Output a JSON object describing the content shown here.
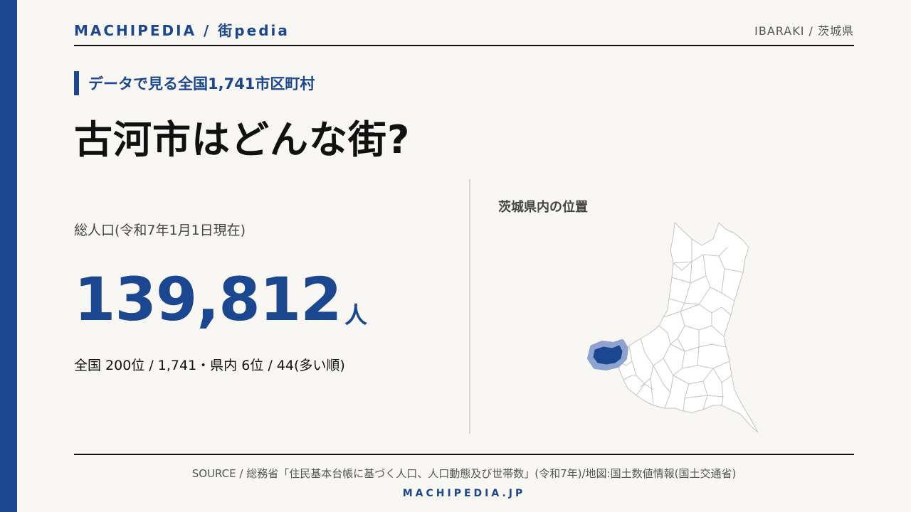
{
  "header": {
    "brand": "MACHIPEDIA / 街pedia",
    "prefecture": "IBARAKI / 茨城県"
  },
  "kicker": "データで見る全国1,741市区町村",
  "title": "古河市はどんな街?",
  "population": {
    "label": "総人口(令和7年1月1日現在)",
    "value": "139,812",
    "unit": "人",
    "rank": "全国 200位 / 1,741・県内 6位 / 44(多い順)"
  },
  "map": {
    "label": "茨城県内の位置",
    "highlight_color": "#1b4690",
    "highlight_ring_color": "#8ea3cf"
  },
  "footer": {
    "source": "SOURCE / 総務省「住民基本台帳に基づく人口、人口動態及び世帯数」(令和7年)/地図:国土数値情報(国土交通省)",
    "site": "MACHIPEDIA.JP"
  },
  "colors": {
    "accent": "#1b4690",
    "background": "#f8f7f3"
  }
}
